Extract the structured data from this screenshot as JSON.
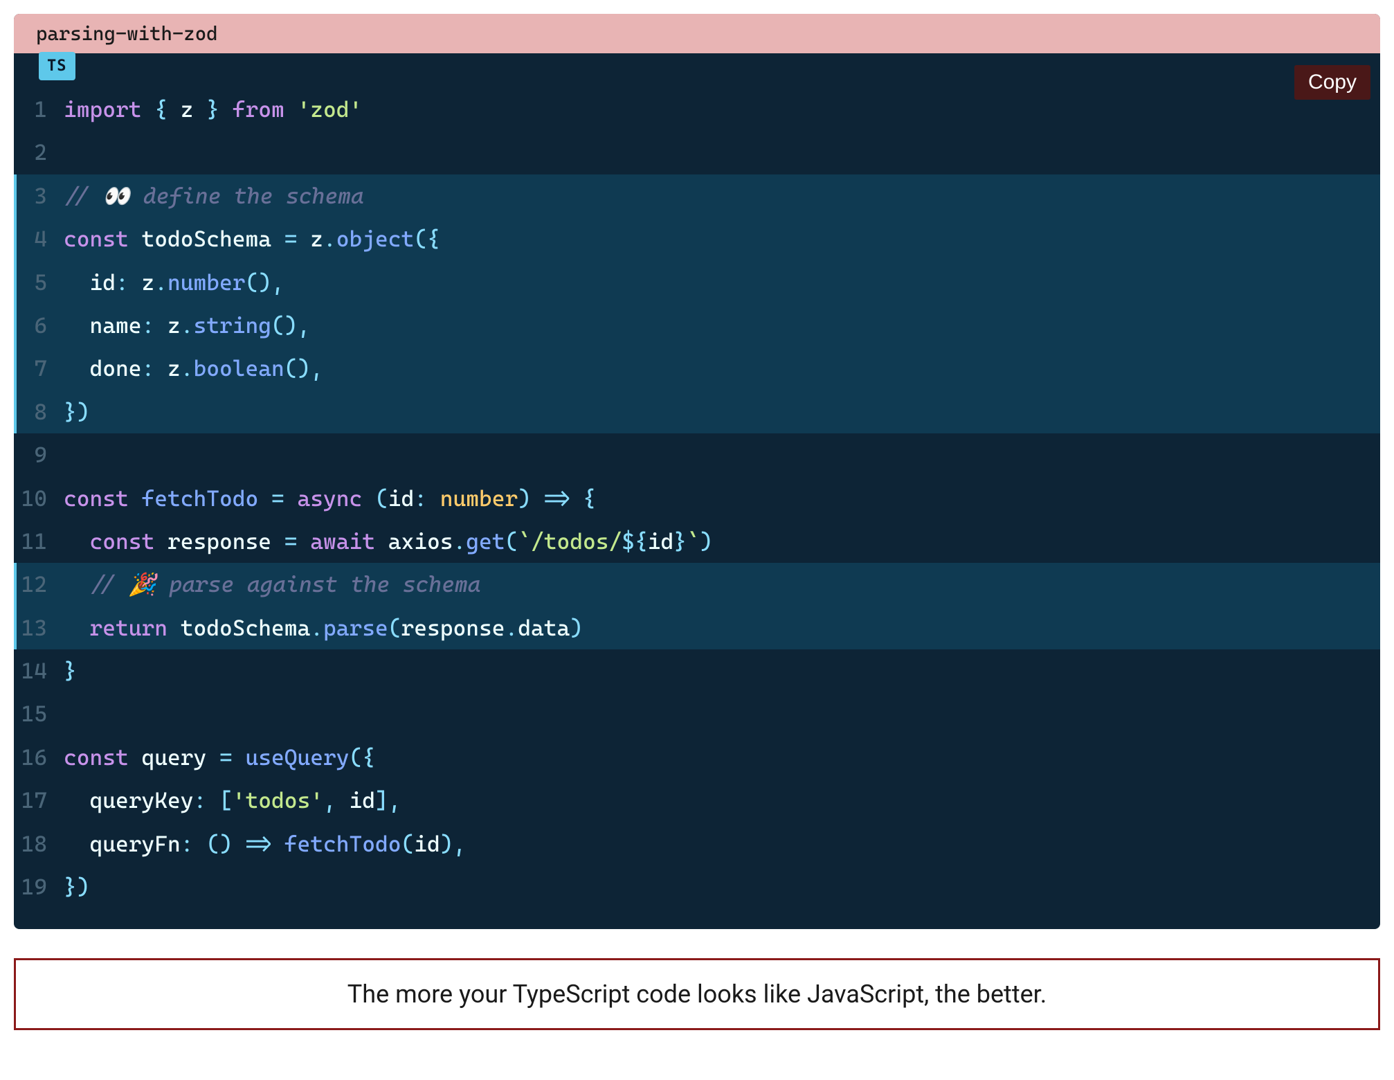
{
  "header": {
    "title": "parsing-with-zod",
    "lang_badge": "TS",
    "copy_label": "Copy"
  },
  "code": {
    "lines": [
      {
        "num": "1",
        "hl": false,
        "tokens": [
          {
            "t": "import",
            "c": "tok-kw"
          },
          {
            "t": " ",
            "c": ""
          },
          {
            "t": "{",
            "c": "tok-punc"
          },
          {
            "t": " z ",
            "c": "tok-var"
          },
          {
            "t": "}",
            "c": "tok-punc"
          },
          {
            "t": " ",
            "c": ""
          },
          {
            "t": "from",
            "c": "tok-kw"
          },
          {
            "t": " ",
            "c": ""
          },
          {
            "t": "'zod'",
            "c": "tok-str"
          }
        ]
      },
      {
        "num": "2",
        "hl": false,
        "tokens": []
      },
      {
        "num": "3",
        "hl": true,
        "tokens": [
          {
            "t": "// 👀 define the schema",
            "c": "tok-comment"
          }
        ]
      },
      {
        "num": "4",
        "hl": true,
        "tokens": [
          {
            "t": "const",
            "c": "tok-kw"
          },
          {
            "t": " todoSchema ",
            "c": "tok-var"
          },
          {
            "t": "=",
            "c": "tok-punc"
          },
          {
            "t": " z",
            "c": "tok-var"
          },
          {
            "t": ".",
            "c": "tok-punc"
          },
          {
            "t": "object",
            "c": "tok-fn"
          },
          {
            "t": "({",
            "c": "tok-punc"
          }
        ]
      },
      {
        "num": "5",
        "hl": true,
        "tokens": [
          {
            "t": "  id",
            "c": "tok-prop"
          },
          {
            "t": ":",
            "c": "tok-punc"
          },
          {
            "t": " z",
            "c": "tok-var"
          },
          {
            "t": ".",
            "c": "tok-punc"
          },
          {
            "t": "number",
            "c": "tok-fn"
          },
          {
            "t": "(),",
            "c": "tok-punc"
          }
        ]
      },
      {
        "num": "6",
        "hl": true,
        "tokens": [
          {
            "t": "  name",
            "c": "tok-prop"
          },
          {
            "t": ":",
            "c": "tok-punc"
          },
          {
            "t": " z",
            "c": "tok-var"
          },
          {
            "t": ".",
            "c": "tok-punc"
          },
          {
            "t": "string",
            "c": "tok-fn"
          },
          {
            "t": "(),",
            "c": "tok-punc"
          }
        ]
      },
      {
        "num": "7",
        "hl": true,
        "tokens": [
          {
            "t": "  done",
            "c": "tok-prop"
          },
          {
            "t": ":",
            "c": "tok-punc"
          },
          {
            "t": " z",
            "c": "tok-var"
          },
          {
            "t": ".",
            "c": "tok-punc"
          },
          {
            "t": "boolean",
            "c": "tok-fn"
          },
          {
            "t": "(),",
            "c": "tok-punc"
          }
        ]
      },
      {
        "num": "8",
        "hl": true,
        "tokens": [
          {
            "t": "})",
            "c": "tok-punc"
          }
        ]
      },
      {
        "num": "9",
        "hl": false,
        "tokens": []
      },
      {
        "num": "10",
        "hl": false,
        "tokens": [
          {
            "t": "const",
            "c": "tok-kw"
          },
          {
            "t": " ",
            "c": ""
          },
          {
            "t": "fetchTodo",
            "c": "tok-fn"
          },
          {
            "t": " ",
            "c": ""
          },
          {
            "t": "=",
            "c": "tok-punc"
          },
          {
            "t": " ",
            "c": ""
          },
          {
            "t": "async",
            "c": "tok-kw"
          },
          {
            "t": " ",
            "c": ""
          },
          {
            "t": "(",
            "c": "tok-punc"
          },
          {
            "t": "id",
            "c": "tok-var"
          },
          {
            "t": ":",
            "c": "tok-punc"
          },
          {
            "t": " ",
            "c": ""
          },
          {
            "t": "number",
            "c": "tok-type"
          },
          {
            "t": ")",
            "c": "tok-punc"
          },
          {
            "t": " ",
            "c": ""
          },
          {
            "t": "=>",
            "c": "tok-punc"
          },
          {
            "t": " ",
            "c": ""
          },
          {
            "t": "{",
            "c": "tok-punc"
          }
        ]
      },
      {
        "num": "11",
        "hl": false,
        "tokens": [
          {
            "t": "  ",
            "c": ""
          },
          {
            "t": "const",
            "c": "tok-kw"
          },
          {
            "t": " response ",
            "c": "tok-var"
          },
          {
            "t": "=",
            "c": "tok-punc"
          },
          {
            "t": " ",
            "c": ""
          },
          {
            "t": "await",
            "c": "tok-kw"
          },
          {
            "t": " axios",
            "c": "tok-var"
          },
          {
            "t": ".",
            "c": "tok-punc"
          },
          {
            "t": "get",
            "c": "tok-fn"
          },
          {
            "t": "(",
            "c": "tok-punc"
          },
          {
            "t": "`/todos/",
            "c": "tok-temp"
          },
          {
            "t": "${",
            "c": "tok-punc"
          },
          {
            "t": "id",
            "c": "tok-interp"
          },
          {
            "t": "}",
            "c": "tok-punc"
          },
          {
            "t": "`",
            "c": "tok-temp"
          },
          {
            "t": ")",
            "c": "tok-punc"
          }
        ]
      },
      {
        "num": "12",
        "hl": true,
        "tokens": [
          {
            "t": "  ",
            "c": ""
          },
          {
            "t": "// 🎉 parse against the schema",
            "c": "tok-comment"
          }
        ]
      },
      {
        "num": "13",
        "hl": true,
        "tokens": [
          {
            "t": "  ",
            "c": ""
          },
          {
            "t": "return",
            "c": "tok-kw"
          },
          {
            "t": " todoSchema",
            "c": "tok-var"
          },
          {
            "t": ".",
            "c": "tok-punc"
          },
          {
            "t": "parse",
            "c": "tok-fn"
          },
          {
            "t": "(",
            "c": "tok-punc"
          },
          {
            "t": "response",
            "c": "tok-var"
          },
          {
            "t": ".",
            "c": "tok-punc"
          },
          {
            "t": "data",
            "c": "tok-prop"
          },
          {
            "t": ")",
            "c": "tok-punc"
          }
        ]
      },
      {
        "num": "14",
        "hl": false,
        "tokens": [
          {
            "t": "}",
            "c": "tok-punc"
          }
        ]
      },
      {
        "num": "15",
        "hl": false,
        "tokens": []
      },
      {
        "num": "16",
        "hl": false,
        "tokens": [
          {
            "t": "const",
            "c": "tok-kw"
          },
          {
            "t": " query ",
            "c": "tok-var"
          },
          {
            "t": "=",
            "c": "tok-punc"
          },
          {
            "t": " ",
            "c": ""
          },
          {
            "t": "useQuery",
            "c": "tok-fn"
          },
          {
            "t": "({",
            "c": "tok-punc"
          }
        ]
      },
      {
        "num": "17",
        "hl": false,
        "tokens": [
          {
            "t": "  queryKey",
            "c": "tok-prop"
          },
          {
            "t": ":",
            "c": "tok-punc"
          },
          {
            "t": " ",
            "c": ""
          },
          {
            "t": "[",
            "c": "tok-punc"
          },
          {
            "t": "'todos'",
            "c": "tok-str"
          },
          {
            "t": ",",
            "c": "tok-punc"
          },
          {
            "t": " id",
            "c": "tok-var"
          },
          {
            "t": "],",
            "c": "tok-punc"
          }
        ]
      },
      {
        "num": "18",
        "hl": false,
        "tokens": [
          {
            "t": "  queryFn",
            "c": "tok-prop"
          },
          {
            "t": ":",
            "c": "tok-punc"
          },
          {
            "t": " ",
            "c": ""
          },
          {
            "t": "()",
            "c": "tok-punc"
          },
          {
            "t": " ",
            "c": ""
          },
          {
            "t": "=>",
            "c": "tok-punc"
          },
          {
            "t": " ",
            "c": ""
          },
          {
            "t": "fetchTodo",
            "c": "tok-fn"
          },
          {
            "t": "(",
            "c": "tok-punc"
          },
          {
            "t": "id",
            "c": "tok-var"
          },
          {
            "t": "),",
            "c": "tok-punc"
          }
        ]
      },
      {
        "num": "19",
        "hl": false,
        "tokens": [
          {
            "t": "})",
            "c": "tok-punc"
          }
        ]
      }
    ]
  },
  "callout": {
    "text": "The more your TypeScript code looks like JavaScript, the better."
  }
}
